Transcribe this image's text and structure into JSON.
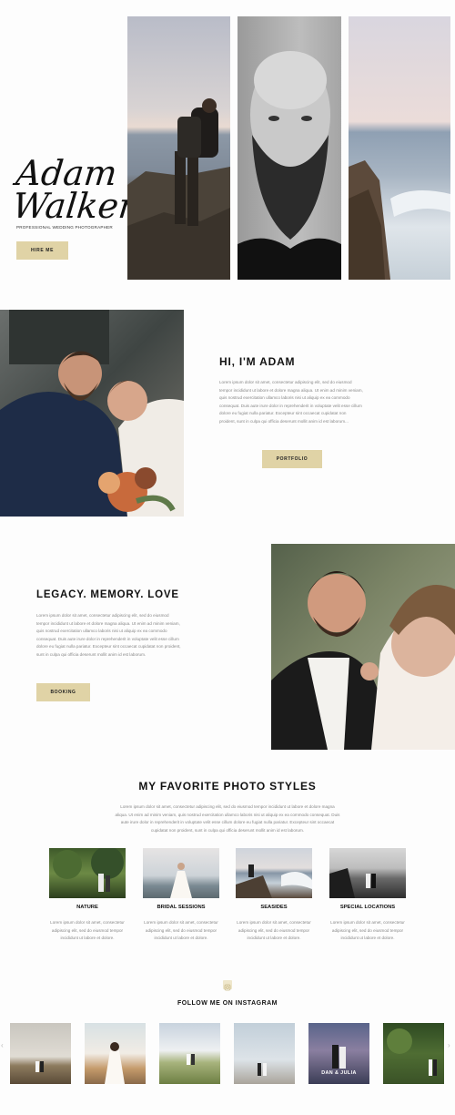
{
  "hero": {
    "name_line1": "Adam",
    "name_line2": "Walker",
    "subtitle": "PROFESSIONAL WEDDING PHOTOGRAPHER",
    "hire_button": "HIRE ME"
  },
  "about": {
    "heading": "HI, I'M ADAM",
    "body": "Lorem ipsum dolor sit amet, consectetur adipiscing elit, sed do eiusmod tempor incididunt ut labore et dolore magna aliqua. Ut enim ad minim veniam, quis nostrud exercitation ullamco laboris nisi ut aliquip ex ea commodo consequat. Duis aute irure dolor in reprehenderit in voluptate velit esse cillum dolore eu fugiat nulla pariatur. Excepteur sint occaecat cupidatat non proident, sunt in culpa qui officia deserunt mollit anim id est laborum...",
    "button": "PORTFOLIO"
  },
  "legacy": {
    "heading": "LEGACY. MEMORY. LOVE",
    "body": "Lorem ipsum dolor sit amet, consectetur adipiscing elit, sed do eiusmod tempor incididunt ut labore et dolore magna aliqua. Ut enim ad minim veniam, quis nostrud exercitation ullamco laboris nisi ut aliquip ex ea commodo consequat. Duis aute irure dolor in reprehenderit in voluptate velit esse cillum dolore eu fugiat nulla pariatur. Excepteur sint occaecat cupidatat non proident, sunt in culpa qui officia deserunt mollit anim id est laborum.",
    "button": "BOOKING"
  },
  "styles": {
    "heading": "MY FAVORITE PHOTO STYLES",
    "intro": "Lorem ipsum dolor sit amet, consectetur adipiscing elit, sed do eiusmod tempor incididunt ut labore et dolore magna aliqua. Ut enim ad minim veniam, quis nostrud exercitation ullamco laboris nisi ut aliquip ex ea commodo consequat. Duis aute irure dolor in reprehenderit in voluptate velit esse cillum dolore eu fugiat nulla pariatur. Excepteur sint occaecat cupidatat non proident, sunt in culpa qui officia deserunt mollit anim id est laborum.",
    "items": [
      {
        "title": "NATURE",
        "text": "Lorem ipsum dolor sit amet, consectetur adipiscing elit, sed do eiusmod tempor incididunt ut labore et dolore."
      },
      {
        "title": "BRIDAL SESSIONS",
        "text": "Lorem ipsum dolor sit amet, consectetur adipiscing elit, sed do eiusmod tempor incididunt ut labore et dolore."
      },
      {
        "title": "SEASIDES",
        "text": "Lorem ipsum dolor sit amet, consectetur adipiscing elit, sed do eiusmod tempor incididunt ut labore et dolore."
      },
      {
        "title": "SPECIAL LOCATIONS",
        "text": "Lorem ipsum dolor sit amet, consectetur adipiscing elit, sed do eiusmod tempor incididunt ut labore et dolore."
      }
    ]
  },
  "instagram": {
    "heading": "FOLLOW ME ON INSTAGRAM",
    "caption": "DAN & JULIA"
  },
  "colors": {
    "accent": "#e0d3a6",
    "text_dark": "#111111",
    "text_muted": "#888888"
  }
}
